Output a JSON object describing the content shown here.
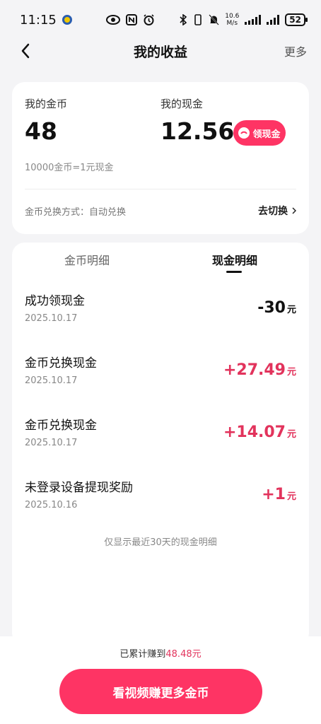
{
  "status_bar": {
    "time": "11:15",
    "speed_value": "10.6",
    "speed_unit": "M/s",
    "battery": "52"
  },
  "nav": {
    "title": "我的收益",
    "more": "更多"
  },
  "summary": {
    "coins_label": "我的金币",
    "coins_value": "48",
    "cash_label": "我的现金",
    "cash_value": "12.56",
    "claim_button": "领现金",
    "rate": "10000金币=1元现金",
    "method_label": "金币兑换方式：自动兑换",
    "switch_label": "去切换"
  },
  "tabs": [
    {
      "label": "金币明细"
    },
    {
      "label": "现金明细"
    }
  ],
  "records": [
    {
      "title": "成功领现金",
      "date": "2025.10.17",
      "amount": "-30",
      "unit": "元"
    },
    {
      "title": "金币兑换现金",
      "date": "2025.10.17",
      "amount": "+27.49",
      "unit": "元"
    },
    {
      "title": "金币兑换现金",
      "date": "2025.10.17",
      "amount": "+14.07",
      "unit": "元"
    },
    {
      "title": "未登录设备提现奖励",
      "date": "2025.10.16",
      "amount": "+1",
      "unit": "元"
    }
  ],
  "note": "仅显示最近30天的现金明细",
  "footer": {
    "earned_prefix": "已累计赚到",
    "earned_amount": "48.48元",
    "cta": "看视频赚更多金币"
  },
  "colors": {
    "accent": "#fe3464",
    "positive": "#e2335c",
    "background": "#f4f4f6"
  }
}
